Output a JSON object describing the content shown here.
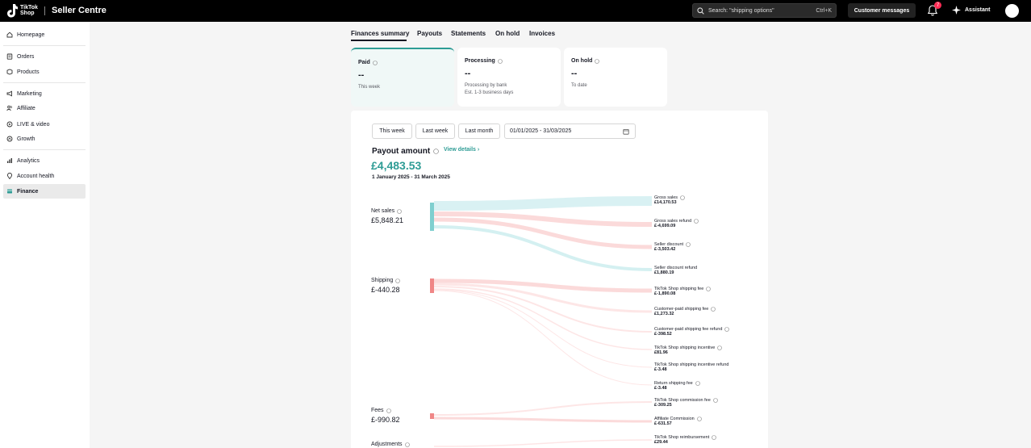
{
  "app": {
    "logo_text": "TikTok Shop",
    "title": "Seller Centre"
  },
  "search": {
    "placeholder": "Search: \"shipping options\"",
    "shortcut": "Ctrl+K"
  },
  "header": {
    "customer_messages": "Customer messages",
    "notification_count": "7",
    "assistant": "Assistant"
  },
  "sidebar": {
    "items": [
      {
        "label": "Homepage",
        "icon": "home-icon"
      },
      {
        "label": "Orders",
        "icon": "orders-icon"
      },
      {
        "label": "Products",
        "icon": "products-icon"
      },
      {
        "label": "Marketing",
        "icon": "megaphone-icon"
      },
      {
        "label": "Affiliate",
        "icon": "people-icon"
      },
      {
        "label": "LIVE & video",
        "icon": "live-icon"
      },
      {
        "label": "Growth",
        "icon": "growth-icon"
      },
      {
        "label": "Analytics",
        "icon": "chart-icon"
      },
      {
        "label": "Account health",
        "icon": "pin-icon"
      },
      {
        "label": "Finance",
        "icon": "finance-icon",
        "active": true
      }
    ]
  },
  "tabs": [
    "Finances summary",
    "Payouts",
    "Statements",
    "On hold",
    "Invoices"
  ],
  "cards": [
    {
      "title": "Paid",
      "value": "--",
      "sub1": "This week",
      "sub2": ""
    },
    {
      "title": "Processing",
      "value": "--",
      "sub1": "Processing by bank",
      "sub2": "Est. 1-3 business days"
    },
    {
      "title": "On hold",
      "value": "--",
      "sub1": "To date",
      "sub2": ""
    }
  ],
  "range_buttons": [
    "This week",
    "Last week",
    "Last month"
  ],
  "date_range": "01/01/2025 - 31/03/2025",
  "payout": {
    "label": "Payout amount",
    "view_details": "View details",
    "amount": "£4,483.53",
    "period": "1 January 2025 - 31 March 2025"
  },
  "breakdown_left": [
    {
      "name": "Net sales",
      "value": "£5,848.21",
      "color": "#7fcfcf"
    },
    {
      "name": "Shipping",
      "value": "£-440.28",
      "color": "#f08686"
    },
    {
      "name": "Fees",
      "value": "£-990.82",
      "color": "#f08686"
    },
    {
      "name": "Adjustments",
      "value": ""
    }
  ],
  "breakdown_right": [
    {
      "name": "Gross sales",
      "value": "£14,170.53",
      "info": true
    },
    {
      "name": "Gross sales refund",
      "value": "£-4,699.09",
      "info": true
    },
    {
      "name": "Seller discount",
      "value": "£-3,503.42",
      "info": true
    },
    {
      "name": "Seller discount refund",
      "value": "£1,880.19",
      "info": false
    },
    {
      "name": "TikTok Shop shipping fee",
      "value": "£-1,890.08",
      "info": true
    },
    {
      "name": "Customer-paid shipping fee",
      "value": "£1,273.32",
      "info": true
    },
    {
      "name": "Customer-paid shipping fee refund",
      "value": "£-398.52",
      "info": true
    },
    {
      "name": "TikTok Shop shipping incentive",
      "value": "£81.96",
      "info": true
    },
    {
      "name": "TikTok Shop shipping incentive refund",
      "value": "£-3.48",
      "info": false
    },
    {
      "name": "Return shipping fee",
      "value": "£-3.48",
      "info": true
    },
    {
      "name": "TikTok Shop commission fee",
      "value": "£-309.25",
      "info": true
    },
    {
      "name": "Affiliate Commission",
      "value": "£-631.57",
      "info": true
    },
    {
      "name": "TikTok Shop reimbursement",
      "value": "£29.44",
      "info": true
    }
  ],
  "colors": {
    "accent": "#2e9c95",
    "positive_flow": "#7fcfcf",
    "negative_flow": "#f08686"
  }
}
